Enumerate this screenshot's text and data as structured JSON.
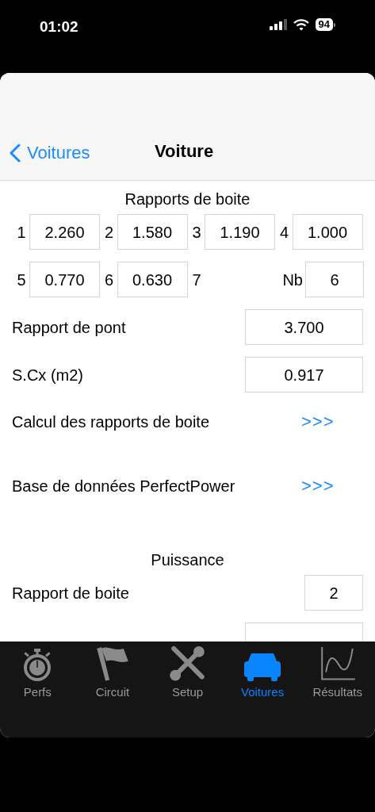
{
  "status_bar": {
    "time": "01:02",
    "battery": "94"
  },
  "nav": {
    "back": "Voitures",
    "title": "Voiture"
  },
  "gearbox": {
    "title": "Rapports de boite",
    "gears": [
      {
        "label": "1",
        "value": "2.260"
      },
      {
        "label": "2",
        "value": "1.580"
      },
      {
        "label": "3",
        "value": "1.190"
      },
      {
        "label": "4",
        "value": "1.000"
      },
      {
        "label": "5",
        "value": "0.770"
      },
      {
        "label": "6",
        "value": "0.630"
      },
      {
        "label": "7"
      }
    ],
    "count": {
      "label": "Nb",
      "value": "6"
    }
  },
  "fields": [
    {
      "label": "Rapport de pont",
      "value": "3.700"
    },
    {
      "label": "S.Cx (m2)",
      "value": "0.917"
    }
  ],
  "links": [
    {
      "label": "Calcul des rapports de boite",
      "action": ">>>"
    },
    {
      "label": "Base de données PerfectPower",
      "action": ">>>"
    }
  ],
  "power": {
    "title": "Puissance",
    "fields": [
      {
        "label": "Rapport de boite",
        "value": "2",
        "kind": "small"
      },
      {
        "kind": "partial"
      }
    ]
  },
  "tabs": [
    {
      "label": "Perfs",
      "kind": "stopwatch",
      "selected": false
    },
    {
      "label": "Circuit",
      "kind": "flag",
      "selected": false
    },
    {
      "label": "Setup",
      "kind": "tools",
      "selected": false
    },
    {
      "label": "Voitures",
      "kind": "car",
      "selected": true
    },
    {
      "label": "Résultats",
      "kind": "chart",
      "selected": false
    }
  ]
}
